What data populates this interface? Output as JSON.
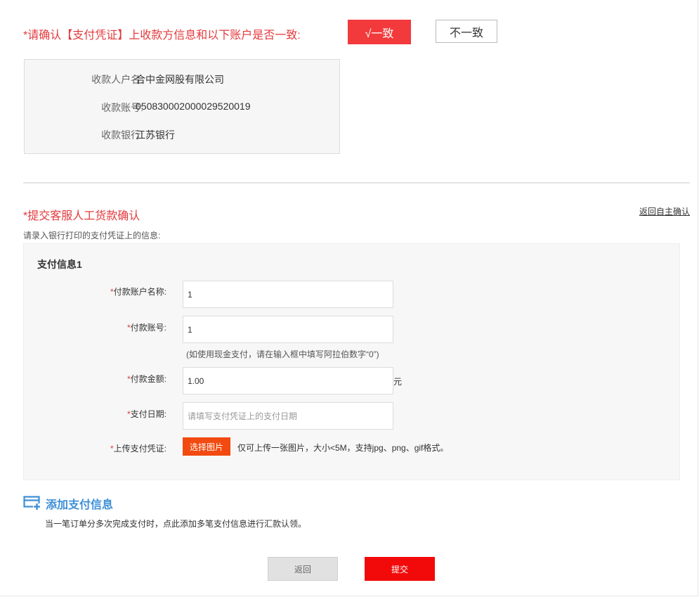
{
  "confirm": {
    "question": "*请确认【支付凭证】上收款方信息和以下账户是否一致:",
    "yes_label": "√一致",
    "no_label": "不一致"
  },
  "payee": {
    "rows": [
      {
        "label": "收款人户名:",
        "value": "合中金网股有限公司"
      },
      {
        "label": "收款账号:",
        "value": "05083000200002952​0019"
      },
      {
        "label": "收款银行:",
        "value": "江苏银行"
      }
    ]
  },
  "manual": {
    "title": "*提交客服人工货款确认",
    "return_link": "返回自主确认",
    "hint": "请录入银行打印的支付凭证上的信息:"
  },
  "payment": {
    "title": "支付信息1",
    "star": "*",
    "fields": {
      "account_name": {
        "label": "付款账户名称:",
        "value": "1"
      },
      "account_no": {
        "label": "付款账号:",
        "value": "1",
        "note": "(如使用现金支付，请在输入框中填写阿拉伯数字“0”)"
      },
      "amount": {
        "label": "付款金额:",
        "value": "1.00",
        "unit": "元"
      },
      "date": {
        "label": "支付日期:",
        "value": "",
        "placeholder": "请填写支付凭证上的支付日期"
      },
      "upload": {
        "label": "上传支付凭证:",
        "button": "选择图片",
        "note": "仅可上传一张图片，大小<5M，支持jpg、png、gif格式。"
      }
    }
  },
  "add_payment": {
    "icon": "add-card-icon",
    "label": "添加支付信息",
    "note": "当一笔订单分多次完成支付时，点此添加多笔支付信息进行汇款认领。"
  },
  "actions": {
    "back_label": "返回",
    "submit_label": "提交"
  },
  "colors": {
    "accent_red": "#e4393c",
    "yes_button": "#f23a3c",
    "upload_button": "#f24a10",
    "submit_button": "#f20a0a",
    "link_blue": "#3d8fd6"
  }
}
